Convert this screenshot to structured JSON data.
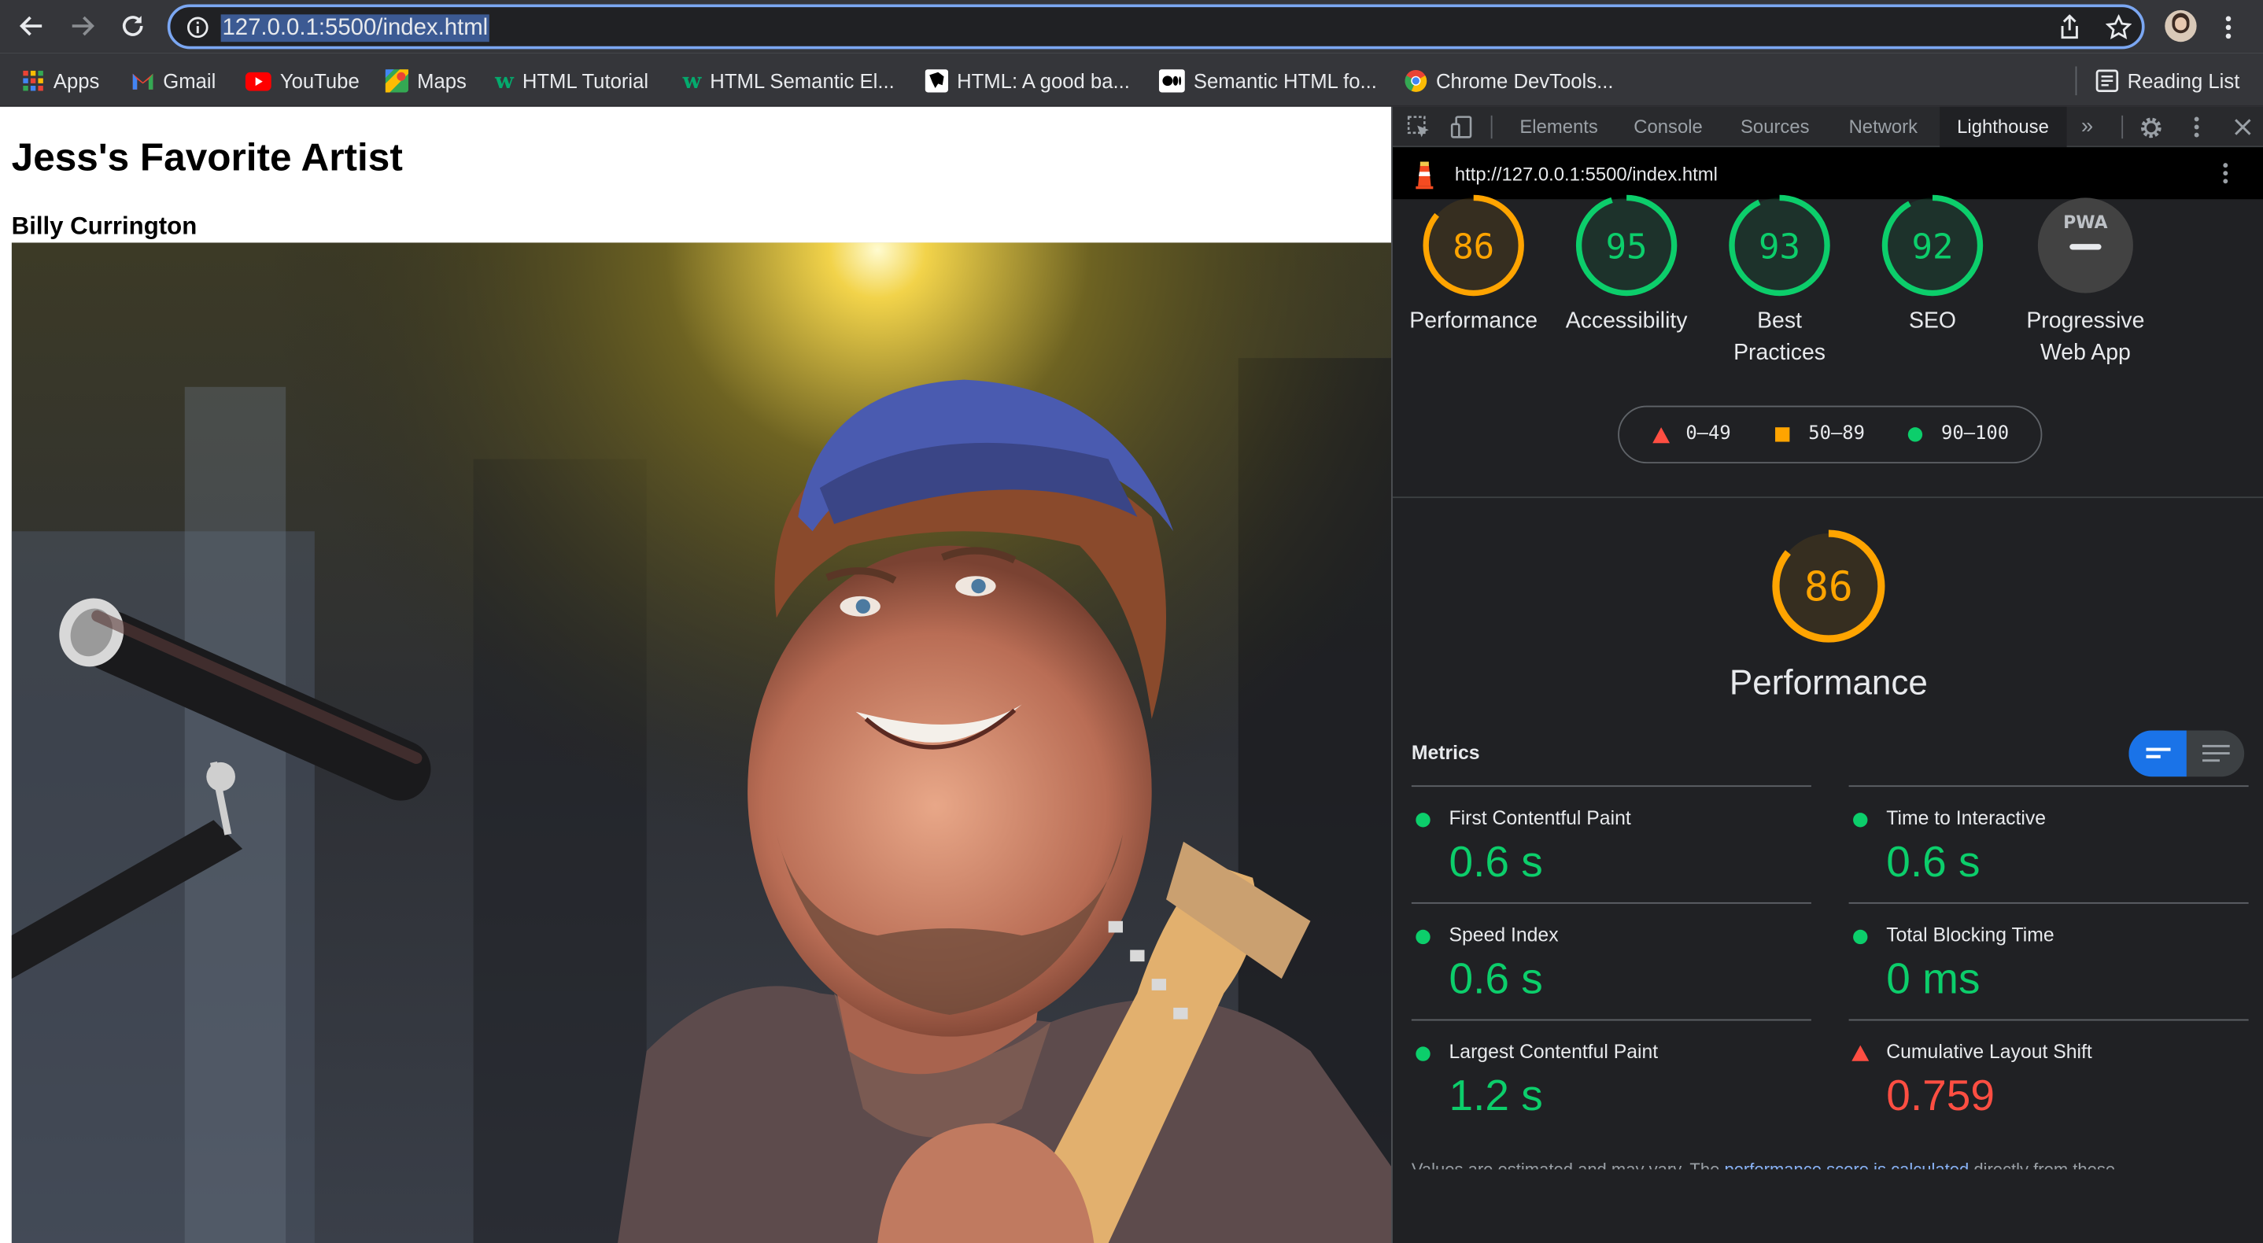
{
  "browser": {
    "url": "127.0.0.1:5500/index.html",
    "bookmarks": [
      {
        "label": "Apps",
        "icon": "apps-grid-icon"
      },
      {
        "label": "Gmail",
        "icon": "gmail-icon"
      },
      {
        "label": "YouTube",
        "icon": "youtube-icon"
      },
      {
        "label": "Maps",
        "icon": "maps-icon"
      },
      {
        "label": "HTML Tutorial",
        "icon": "w3schools-icon"
      },
      {
        "label": "HTML Semantic El...",
        "icon": "w3schools-icon"
      },
      {
        "label": "HTML: A good ba...",
        "icon": "mdn-icon"
      },
      {
        "label": "Semantic HTML fo...",
        "icon": "medium-icon"
      },
      {
        "label": "Chrome DevTools...",
        "icon": "chrome-icon"
      }
    ],
    "reading_list": "Reading List"
  },
  "page": {
    "heading": "Jess's Favorite Artist",
    "subheading": "Billy Currington"
  },
  "devtools": {
    "tabs": [
      "Elements",
      "Console",
      "Sources",
      "Network",
      "Lighthouse"
    ],
    "active_tab": "Lighthouse",
    "report_url": "http://127.0.0.1:5500/index.html",
    "scores": [
      {
        "label": "Performance",
        "value": "86",
        "fraction": 0.86,
        "color": "#ffa400"
      },
      {
        "label": "Accessibility",
        "value": "95",
        "fraction": 0.95,
        "color": "#0cce6b"
      },
      {
        "label": "Best Practices",
        "value": "93",
        "fraction": 0.93,
        "color": "#0cce6b"
      },
      {
        "label": "SEO",
        "value": "92",
        "fraction": 0.92,
        "color": "#0cce6b"
      },
      {
        "label": "Progressive Web App",
        "value": "PWA",
        "fraction": 0,
        "color": "#9aa0a6"
      }
    ],
    "legend": [
      {
        "range": "0–49",
        "color": "#ff4e42"
      },
      {
        "range": "50–89",
        "color": "#ffa400"
      },
      {
        "range": "90–100",
        "color": "#0cce6b"
      }
    ],
    "performance": {
      "score": "86",
      "fraction": 0.86,
      "title": "Performance"
    },
    "metrics_title": "Metrics",
    "metrics": [
      {
        "name": "First Contentful Paint",
        "value": "0.6 s",
        "status": "pass"
      },
      {
        "name": "Time to Interactive",
        "value": "0.6 s",
        "status": "pass"
      },
      {
        "name": "Speed Index",
        "value": "0.6 s",
        "status": "pass"
      },
      {
        "name": "Total Blocking Time",
        "value": "0 ms",
        "status": "pass"
      },
      {
        "name": "Largest Contentful Paint",
        "value": "1.2 s",
        "status": "pass"
      },
      {
        "name": "Cumulative Layout Shift",
        "value": "0.759",
        "status": "fail"
      }
    ],
    "footnote_prefix": "Values are estimated and may vary. The ",
    "footnote_link": "performance score is calculated",
    "footnote_suffix": " directly from these"
  },
  "colors": {
    "pass": "#0cce6b",
    "average": "#ffa400",
    "fail": "#ff4e42"
  }
}
